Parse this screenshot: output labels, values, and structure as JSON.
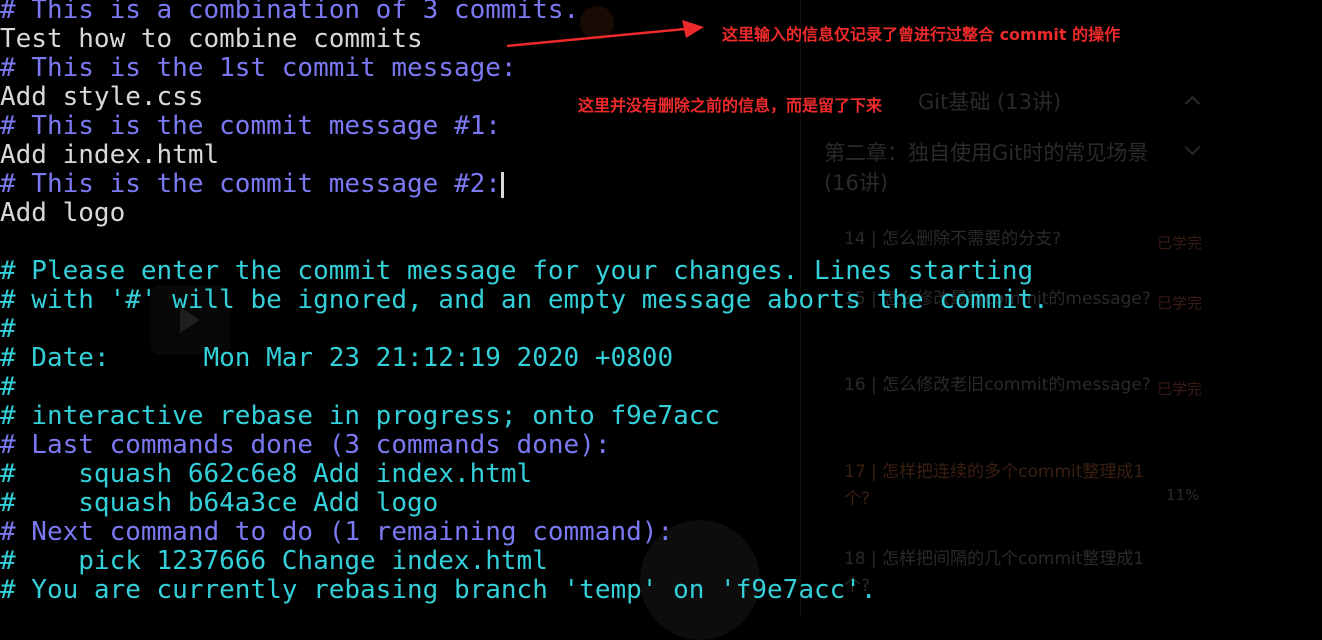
{
  "background": "#000000",
  "colors": {
    "comment_blue": "#7b79f2",
    "comment_cyan": "#33d0da",
    "text": "#d8d8d8",
    "annotation": "#ee2a2a"
  },
  "terminal": {
    "lines": [
      {
        "text": "# This is a combination of 3 commits.",
        "style": "blue"
      },
      {
        "text": "Test how to combine commits",
        "style": "text"
      },
      {
        "text": "# This is the 1st commit message:",
        "style": "blue"
      },
      {
        "text": "Add style.css",
        "style": "text"
      },
      {
        "text": "# This is the commit message #1:",
        "style": "blue"
      },
      {
        "text": "Add index.html",
        "style": "text"
      },
      {
        "text": "# This is the commit message #2:",
        "style": "blue",
        "cursor": true
      },
      {
        "text": "Add logo",
        "style": "text"
      },
      {
        "text": "",
        "style": "text"
      },
      {
        "text": "# Please enter the commit message for your changes. Lines starting",
        "style": "cyan"
      },
      {
        "text": "# with '#' will be ignored, and an empty message aborts the commit.",
        "style": "cyan"
      },
      {
        "text": "#",
        "style": "cyan"
      },
      {
        "text": "# Date:      Mon Mar 23 21:12:19 2020 +0800",
        "style": "cyan"
      },
      {
        "text": "#",
        "style": "cyan"
      },
      {
        "text": "# interactive rebase in progress; onto f9e7acc",
        "style": "cyan"
      },
      {
        "text": "# Last commands done (3 commands done):",
        "style": "blue"
      },
      {
        "text": "#    squash 662c6e8 Add index.html",
        "style": "cyan"
      },
      {
        "text": "#    squash b64a3ce Add logo",
        "style": "cyan"
      },
      {
        "text": "# Next command to do (1 remaining command):",
        "style": "blue"
      },
      {
        "text": "#    pick 1237666 Change index.html",
        "style": "cyan"
      },
      {
        "text": "# You are currently rebasing branch 'temp' on 'f9e7acc'.",
        "style": "cyan"
      }
    ]
  },
  "annotations": {
    "top": "这里输入的信息仅记录了曾进行过整合 commit 的操作",
    "middle": "这里并没有删除之前的信息，而是留了下来"
  },
  "background_panel": {
    "section1": "Git基础 (13讲)",
    "section2": "第二章：独自使用Git时的常见场景 (16讲)",
    "items": [
      {
        "title": "14 | 怎么删除不需要的分支?",
        "status": "已学完"
      },
      {
        "title": "15 | 怎么修改最新commit的message?",
        "status": "已学完"
      },
      {
        "title": "16 | 怎么修改老旧commit的message?",
        "status": "已学完"
      },
      {
        "title": "17 | 怎样把连续的多个commit整理成1个?",
        "status": "11%"
      },
      {
        "title": "18 | 怎样把间隔的几个commit整理成1个?",
        "status": ""
      }
    ]
  }
}
